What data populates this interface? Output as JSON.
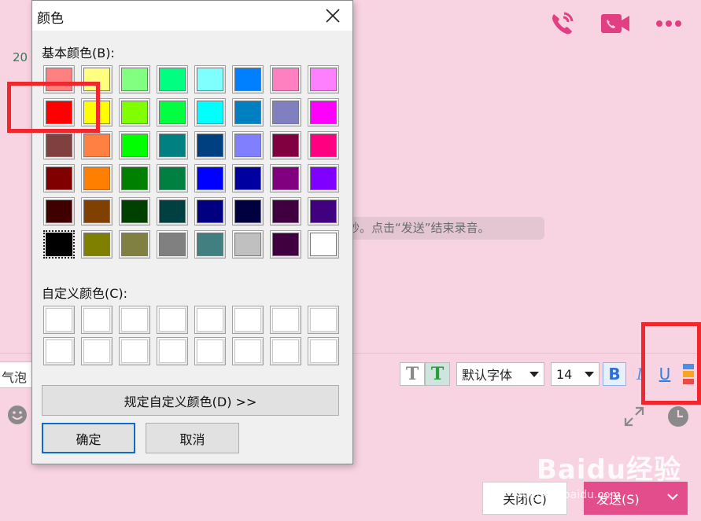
{
  "chat": {
    "date_fragment": "20",
    "system_message": "秒。点击“发送”结束录音。",
    "bubble_label": "气泡",
    "font_select": "默认字体",
    "size_select": "14",
    "bold_label": "B",
    "italic_label": "I",
    "underline_label": "U",
    "text_style_plain": "T",
    "text_style_color": "T",
    "close_button": "关闭(C)",
    "send_button": "发送(S)",
    "watermark": "Baidu经验",
    "watermark_url": "jingyan.baidu.com"
  },
  "dialog": {
    "title": "颜色",
    "basic_label": "基本颜色(B):",
    "custom_label": "自定义颜色(C):",
    "define_button": "规定自定义颜色(D) >>",
    "ok_button": "确定",
    "cancel_button": "取消",
    "selected_index": 40,
    "basic_colors": [
      "#ff8080",
      "#ffff80",
      "#80ff80",
      "#00ff80",
      "#80ffff",
      "#0080ff",
      "#ff80c0",
      "#ff80ff",
      "#ff0000",
      "#ffff00",
      "#80ff00",
      "#00ff40",
      "#00ffff",
      "#0080c0",
      "#8080c0",
      "#ff00ff",
      "#804040",
      "#ff8040",
      "#00ff00",
      "#008080",
      "#004080",
      "#8080ff",
      "#800040",
      "#ff0080",
      "#800000",
      "#ff8000",
      "#008000",
      "#008040",
      "#0000ff",
      "#0000a0",
      "#800080",
      "#8000ff",
      "#400000",
      "#804000",
      "#004000",
      "#004040",
      "#000080",
      "#000040",
      "#400040",
      "#400080",
      "#000000",
      "#808000",
      "#808040",
      "#808080",
      "#408080",
      "#c0c0c0",
      "#400040",
      "#ffffff"
    ],
    "custom_colors": [
      "#ffffff",
      "#ffffff",
      "#ffffff",
      "#ffffff",
      "#ffffff",
      "#ffffff",
      "#ffffff",
      "#ffffff",
      "#ffffff",
      "#ffffff",
      "#ffffff",
      "#ffffff",
      "#ffffff",
      "#ffffff",
      "#ffffff",
      "#ffffff"
    ]
  },
  "colors": {
    "accent": "#e23e82",
    "send": "#e34d8b",
    "annotation": "#f2262d"
  }
}
